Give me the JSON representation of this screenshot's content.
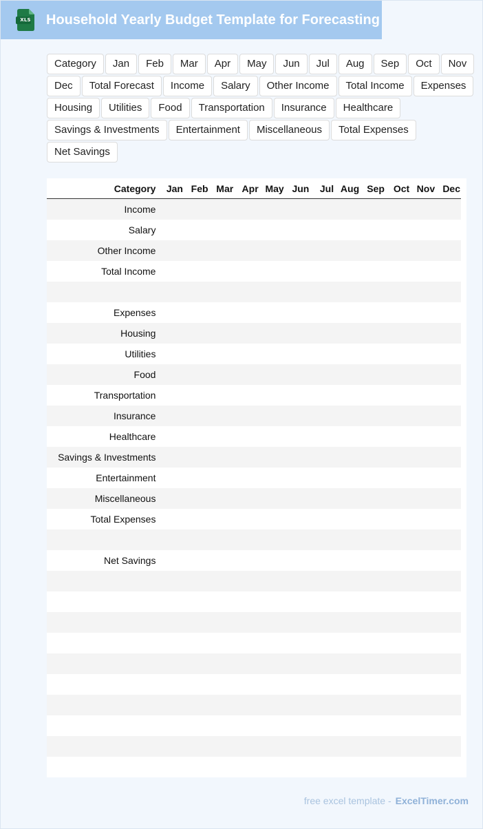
{
  "header": {
    "title": "Household Yearly Budget Template for Forecasting",
    "icon_label": "XLS",
    "icon_color": "#1e7a45",
    "bg_color": "#a4c9ef"
  },
  "chips": [
    "Category",
    "Jan",
    "Feb",
    "Mar",
    "Apr",
    "May",
    "Jun",
    "Jul",
    "Aug",
    "Sep",
    "Oct",
    "Nov",
    "Dec",
    "Total Forecast",
    "Income",
    "Salary",
    "Other Income",
    "Total Income",
    "Expenses",
    "Housing",
    "Utilities",
    "Food",
    "Transportation",
    "Insurance",
    "Healthcare",
    "Savings & Investments",
    "Entertainment",
    "Miscellaneous",
    "Total Expenses",
    "Net Savings"
  ],
  "table": {
    "headers": [
      "",
      "Category",
      "Jan",
      "Feb",
      "Mar",
      "Apr",
      "May",
      "Jun",
      "Jul",
      "Aug",
      "Sep",
      "Oct",
      "Nov",
      "Dec"
    ],
    "rows": [
      {
        "index": "0",
        "category": "Income"
      },
      {
        "index": "1",
        "category": "Salary"
      },
      {
        "index": "2",
        "category": "Other Income"
      },
      {
        "index": "3",
        "category": "Total Income"
      },
      {
        "index": "4",
        "category": ""
      },
      {
        "index": "5",
        "category": "Expenses"
      },
      {
        "index": "6",
        "category": "Housing"
      },
      {
        "index": "7",
        "category": "Utilities"
      },
      {
        "index": "8",
        "category": "Food"
      },
      {
        "index": "9",
        "category": "Transportation"
      },
      {
        "index": "0",
        "category": "Insurance"
      },
      {
        "index": "1",
        "category": "Healthcare"
      },
      {
        "index": "2",
        "category": "Savings & Investments"
      },
      {
        "index": "3",
        "category": "Entertainment"
      },
      {
        "index": "4",
        "category": "Miscellaneous"
      },
      {
        "index": "5",
        "category": "Total Expenses"
      },
      {
        "index": "6",
        "category": ""
      },
      {
        "index": "7",
        "category": "Net Savings"
      },
      {
        "index": "8",
        "category": ""
      },
      {
        "index": "9",
        "category": ""
      },
      {
        "index": "0",
        "category": ""
      },
      {
        "index": "1",
        "category": ""
      },
      {
        "index": "2",
        "category": ""
      },
      {
        "index": "3",
        "category": ""
      },
      {
        "index": "4",
        "category": ""
      },
      {
        "index": "5",
        "category": ""
      },
      {
        "index": "6",
        "category": ""
      },
      {
        "index": "7",
        "category": ""
      }
    ]
  },
  "footer": {
    "text": "free excel template -",
    "brand": "ExcelTimer.com"
  }
}
